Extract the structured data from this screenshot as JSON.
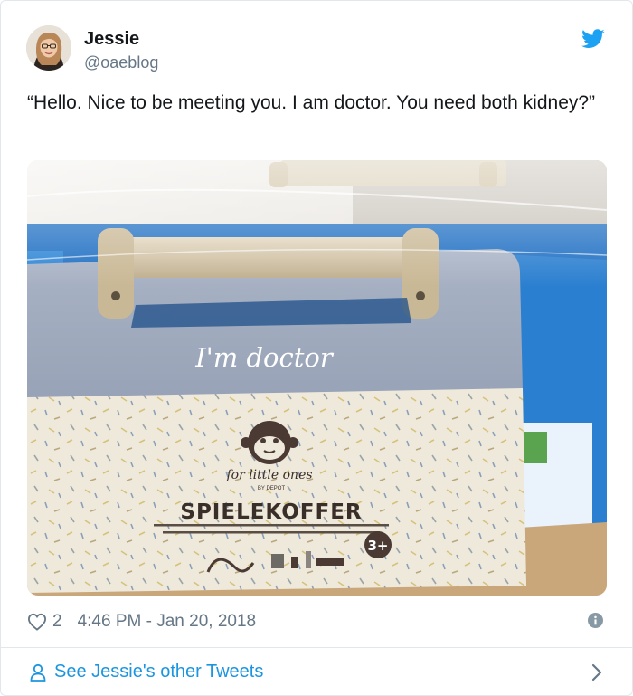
{
  "author": {
    "display_name": "Jessie",
    "handle": "@oaeblog"
  },
  "tweet": {
    "text": "“Hello. Nice to be meeting you. I am doctor. You need both kidney?”",
    "likes": "2",
    "timestamp": "4:46 PM - Jan 20, 2018"
  },
  "photo": {
    "lid_text": "I'm doctor",
    "brand_text": "for little ones",
    "brand_sub": "BY DEPOT",
    "product_name": "SPIELEKOFFER",
    "age_badge": "3+"
  },
  "footer": {
    "label": "See Jessie's other Tweets"
  },
  "colors": {
    "link_blue": "#1b95e0",
    "twitter_blue": "#1da1f2",
    "muted_gray": "#657786",
    "border": "#e1e8ed"
  },
  "icons": [
    "twitter-bird-icon",
    "heart-icon",
    "info-icon",
    "person-icon",
    "chevron-right-icon"
  ]
}
